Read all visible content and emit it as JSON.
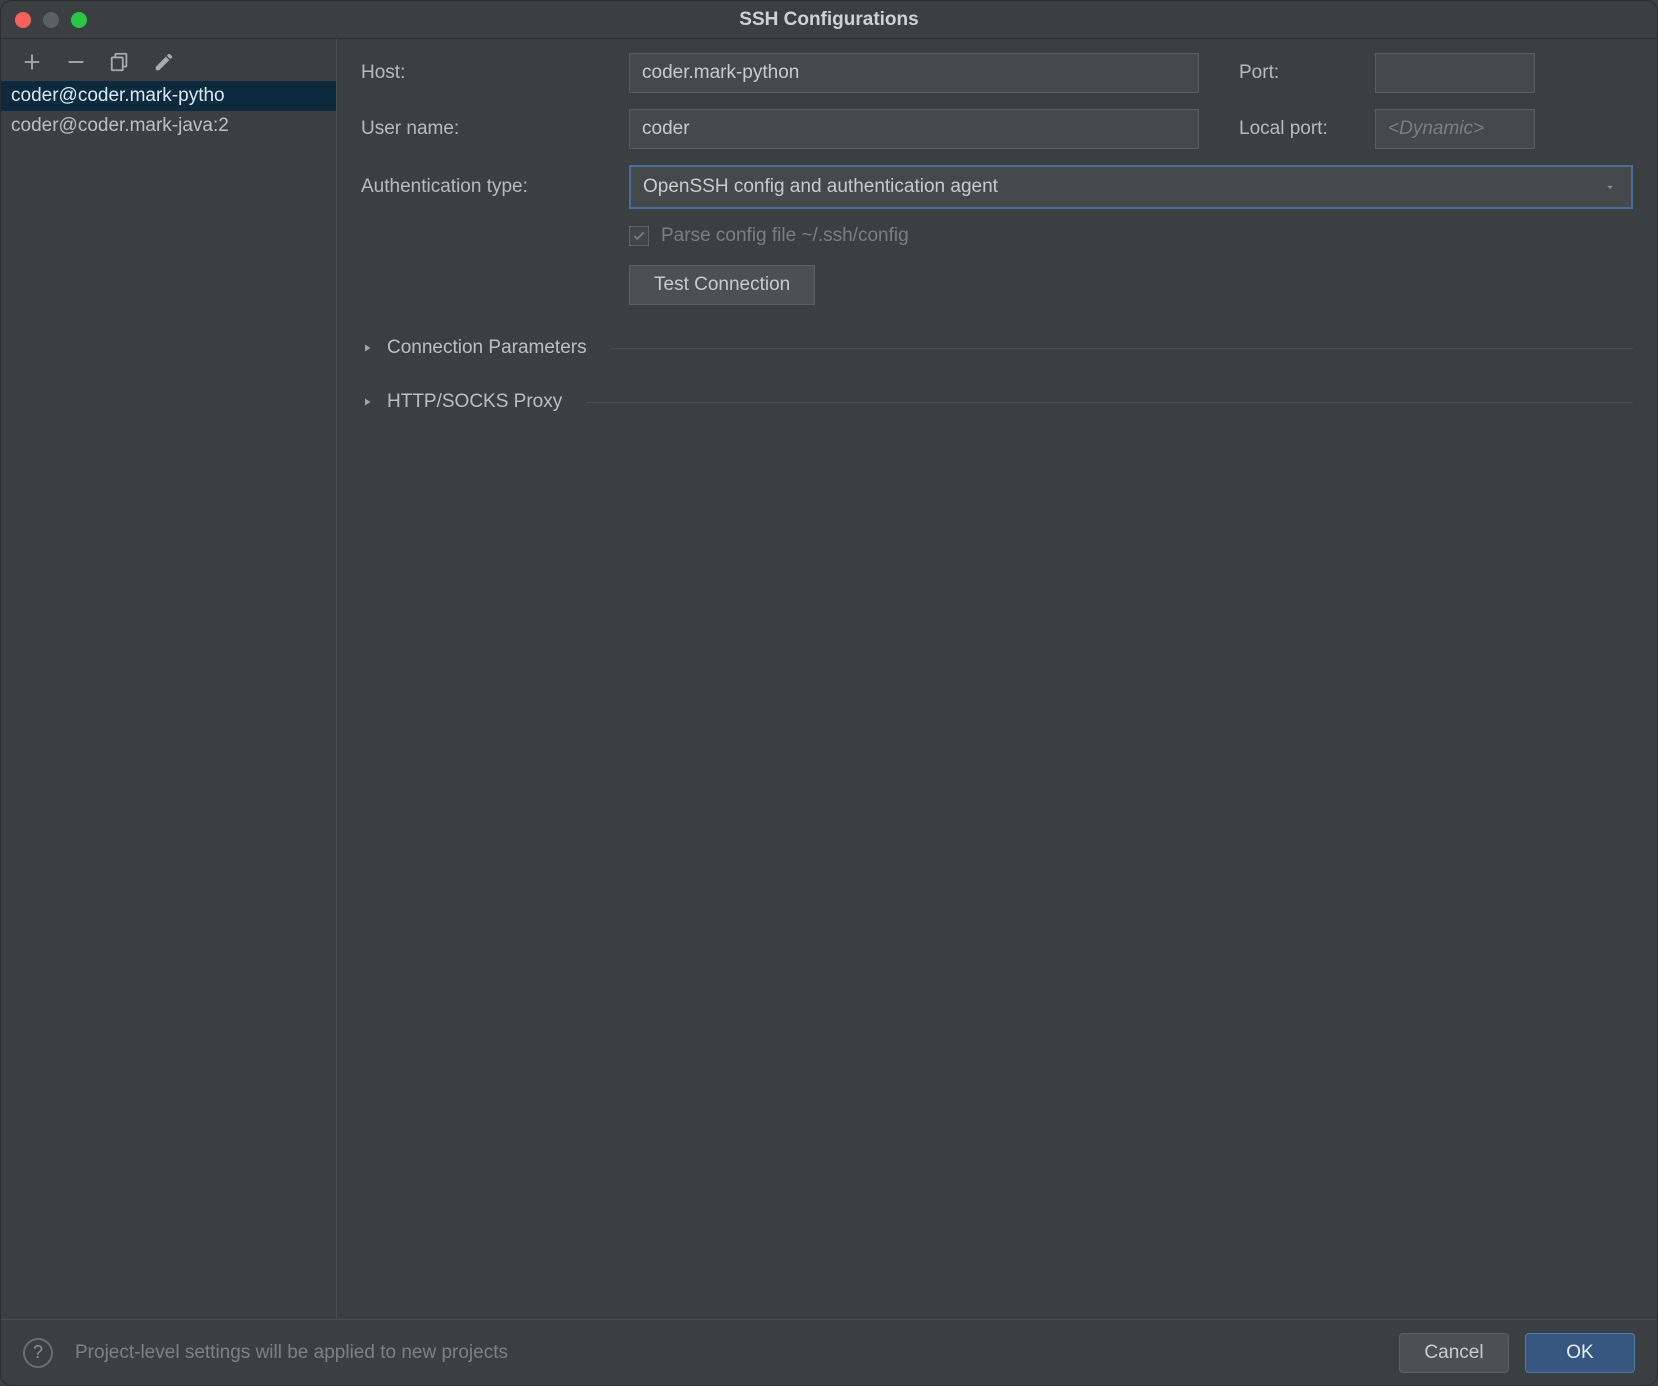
{
  "window": {
    "title": "SSH Configurations"
  },
  "sidebar": {
    "toolbar": {
      "add": "add",
      "remove": "remove",
      "copy": "copy",
      "edit": "edit"
    },
    "items": [
      {
        "label": "coder@coder.mark-pytho"
      },
      {
        "label": "coder@coder.mark-java:2"
      }
    ]
  },
  "form": {
    "host_label": "Host:",
    "host_value": "coder.mark-python",
    "port_label": "Port:",
    "port_value": "",
    "user_label": "User name:",
    "user_value": "coder",
    "localport_label": "Local port:",
    "localport_placeholder": "<Dynamic>",
    "authtype_label": "Authentication type:",
    "authtype_value": "OpenSSH config and authentication agent",
    "parse_config_label": "Parse config file ~/.ssh/config",
    "test_button": "Test Connection"
  },
  "sections": {
    "conn_params": "Connection Parameters",
    "proxy": "HTTP/SOCKS Proxy"
  },
  "footer": {
    "message": "Project-level settings will be applied to new projects",
    "cancel": "Cancel",
    "ok": "OK"
  }
}
